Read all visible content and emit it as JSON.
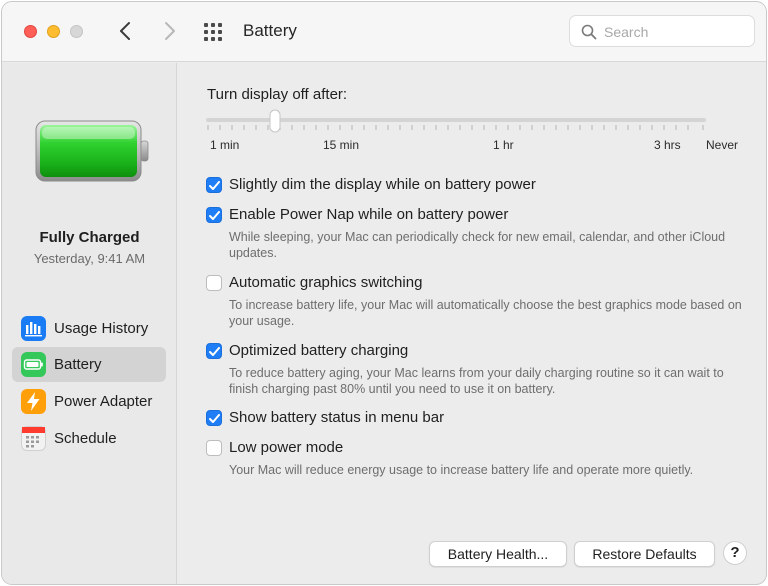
{
  "window": {
    "title": "Battery"
  },
  "search": {
    "placeholder": "Search",
    "value": ""
  },
  "sidebar": {
    "status_title": "Fully Charged",
    "status_time": "Yesterday, 9:41 AM",
    "items": [
      {
        "label": "Usage History",
        "icon": "bar-chart-icon",
        "selected": false,
        "color": "#1a7cf5"
      },
      {
        "label": "Battery",
        "icon": "battery-icon",
        "selected": true,
        "color": "#34c759"
      },
      {
        "label": "Power Adapter",
        "icon": "lightning-icon",
        "selected": false,
        "color": "#ff9f0a"
      },
      {
        "label": "Schedule",
        "icon": "calendar-icon",
        "selected": false,
        "color": "#f2f2f2"
      }
    ]
  },
  "display_off": {
    "label": "Turn display off after:",
    "tick_labels": [
      "1 min",
      "15 min",
      "1 hr",
      "3 hrs",
      "Never"
    ],
    "selected_value": "approximately 5 min"
  },
  "options": [
    {
      "label": "Slightly dim the display while on battery power",
      "checked": true,
      "description": ""
    },
    {
      "label": "Enable Power Nap while on battery power",
      "checked": true,
      "description": "While sleeping, your Mac can periodically check for new email, calendar, and other iCloud updates."
    },
    {
      "label": "Automatic graphics switching",
      "checked": false,
      "description": "To increase battery life, your Mac will automatically choose the best graphics mode based on your usage."
    },
    {
      "label": "Optimized battery charging",
      "checked": true,
      "description": "To reduce battery aging, your Mac learns from your daily charging routine so it can wait to finish charging past 80% until you need to use it on battery."
    },
    {
      "label": "Show battery status in menu bar",
      "checked": true,
      "description": ""
    },
    {
      "label": "Low power mode",
      "checked": false,
      "description": "Your Mac will reduce energy usage to increase battery life and operate more quietly."
    }
  ],
  "buttons": {
    "battery_health": "Battery Health...",
    "restore_defaults": "Restore Defaults",
    "help": "?"
  },
  "colors": {
    "accent": "#1f7ef5",
    "battery_green": "#2fd12f"
  }
}
